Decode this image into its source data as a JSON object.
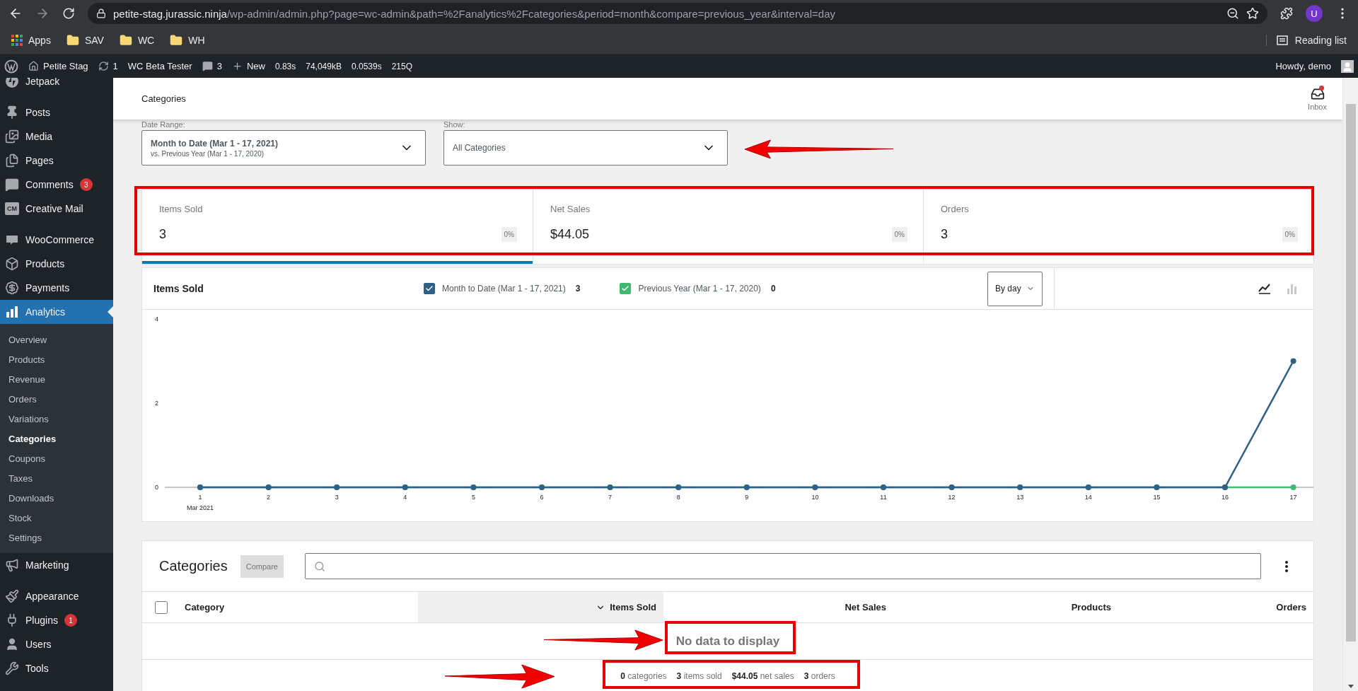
{
  "browser": {
    "url_host": "petite-stag.jurassic.ninja",
    "url_path": "/wp-admin/admin.php?page=wc-admin&path=%2Fanalytics%2Fcategories&period=month&compare=previous_year&interval=day",
    "profile_initial": "U",
    "bookmarks": [
      "Apps",
      "SAV",
      "WC",
      "WH"
    ],
    "reading_list": "Reading list"
  },
  "admin_bar": {
    "site": "Petite Stag",
    "updates": "1",
    "plugin": "WC Beta Tester",
    "comments": "3",
    "new": "New",
    "stats": [
      "0.83s",
      "74,049kB",
      "0.0539s",
      "215Q"
    ],
    "greeting": "Howdy, demo"
  },
  "sidebar": {
    "groups": [
      {
        "items": [
          {
            "label": "Jetpack",
            "selected": false
          }
        ]
      },
      {
        "items": [
          {
            "label": "Posts",
            "selected": false
          },
          {
            "label": "Media",
            "selected": false
          },
          {
            "label": "Pages",
            "selected": false
          },
          {
            "label": "Comments",
            "selected": false,
            "badge": "3"
          },
          {
            "label": "Creative Mail",
            "selected": false,
            "icon_text": "CM"
          }
        ]
      },
      {
        "items": [
          {
            "label": "WooCommerce",
            "selected": false
          },
          {
            "label": "Products",
            "selected": false
          },
          {
            "label": "Payments",
            "selected": false
          },
          {
            "label": "Analytics",
            "selected": true,
            "children": [
              {
                "label": "Overview",
                "selected": false
              },
              {
                "label": "Products",
                "selected": false
              },
              {
                "label": "Revenue",
                "selected": false
              },
              {
                "label": "Orders",
                "selected": false
              },
              {
                "label": "Variations",
                "selected": false
              },
              {
                "label": "Categories",
                "selected": true
              },
              {
                "label": "Coupons",
                "selected": false
              },
              {
                "label": "Taxes",
                "selected": false
              },
              {
                "label": "Downloads",
                "selected": false
              },
              {
                "label": "Stock",
                "selected": false
              },
              {
                "label": "Settings",
                "selected": false
              }
            ]
          },
          {
            "label": "Marketing",
            "selected": false
          }
        ]
      },
      {
        "items": [
          {
            "label": "Appearance",
            "selected": false
          },
          {
            "label": "Plugins",
            "selected": false,
            "badge": "1"
          },
          {
            "label": "Users",
            "selected": false
          },
          {
            "label": "Tools",
            "selected": false
          }
        ]
      }
    ]
  },
  "header": {
    "title": "Categories",
    "inbox": "Inbox",
    "unread": true
  },
  "filters": [
    {
      "label": "Date Range:",
      "value": "Month to Date (Mar 1 - 17, 2021)",
      "secondary": "vs. Previous Year (Mar 1 - 17, 2020)"
    },
    {
      "label": "Show:",
      "value": "All Categories"
    }
  ],
  "summary": [
    {
      "label": "Items Sold",
      "value": "3",
      "delta": "0%",
      "selected": true
    },
    {
      "label": "Net Sales",
      "value": "$44.05",
      "delta": "0%",
      "selected": false
    },
    {
      "label": "Orders",
      "value": "3",
      "delta": "0%",
      "selected": false
    }
  ],
  "chart": {
    "title": "Items Sold",
    "legend": [
      {
        "total": "3",
        "checked": true
      },
      {
        "total": "0",
        "checked": true
      }
    ],
    "interval": "By day",
    "chart_types": [
      {
        "kind": "line",
        "selected": true
      },
      {
        "kind": "bar",
        "selected": false
      }
    ],
    "chart_data": {
      "type": "line",
      "categories": [
        "1",
        "2",
        "3",
        "4",
        "5",
        "6",
        "7",
        "8",
        "9",
        "10",
        "11",
        "12",
        "13",
        "14",
        "15",
        "16",
        "17"
      ],
      "series": [
        {
          "name": "Month to Date (Mar 1 - 17, 2021)",
          "color": "#2f6187",
          "marker": "circle",
          "values": [
            0,
            0,
            0,
            0,
            0,
            0,
            0,
            0,
            0,
            0,
            0,
            0,
            0,
            0,
            0,
            0,
            3
          ]
        },
        {
          "name": "Previous Year (Mar 1 - 17, 2020)",
          "color": "#3fb870",
          "marker": "circle",
          "values": [
            0,
            0,
            0,
            0,
            0,
            0,
            0,
            0,
            0,
            0,
            0,
            0,
            0,
            0,
            0,
            0,
            0
          ]
        }
      ],
      "ylim": [
        0,
        4
      ],
      "yticks": [
        0,
        2,
        4
      ],
      "annotations": [
        "Mar 2021"
      ]
    }
  },
  "table": {
    "title": "Categories",
    "compare": "Compare",
    "select_all_checked": false,
    "columns": [
      {
        "label": "Category",
        "sorted": false
      },
      {
        "label": "Items Sold",
        "sorted": true
      },
      {
        "label": "Net Sales",
        "sorted": false
      },
      {
        "label": "Products",
        "sorted": false
      },
      {
        "label": "Orders",
        "sorted": false
      }
    ],
    "empty": "No data to display",
    "totals": [
      "**0** categories",
      "**3** items sold",
      "**$44.05** net sales",
      "**3** orders"
    ]
  }
}
